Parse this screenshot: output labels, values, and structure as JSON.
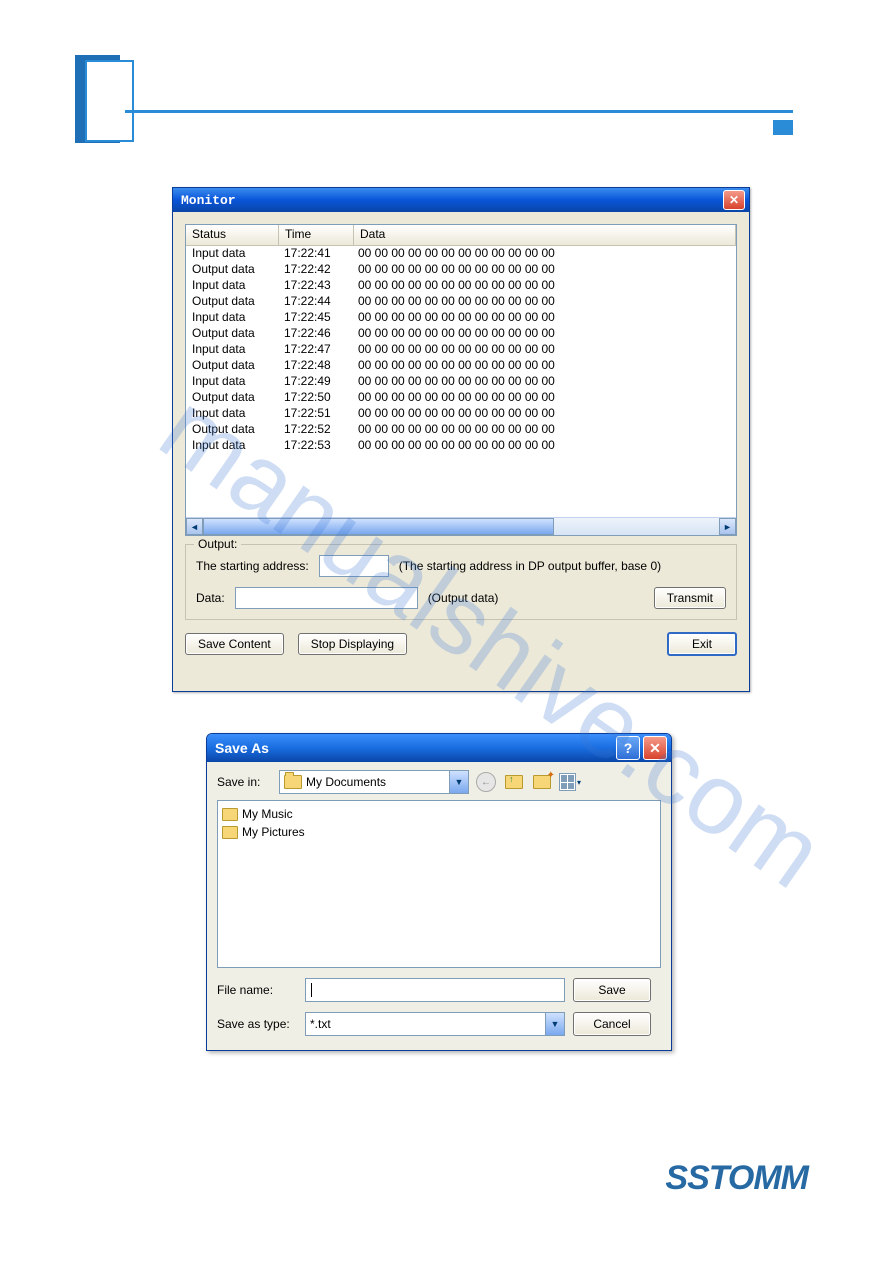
{
  "watermark": "manualshive.com",
  "logo": "SSTOMM",
  "monitor": {
    "title": "Monitor",
    "columns": {
      "status": "Status",
      "time": "Time",
      "data": "Data"
    },
    "rows": [
      {
        "status": "Input data",
        "time": "17:22:41",
        "data": "00 00 00 00 00 00 00 00 00 00 00 00"
      },
      {
        "status": "Output data",
        "time": "17:22:42",
        "data": "00 00 00 00 00 00 00 00 00 00 00 00"
      },
      {
        "status": "Input data",
        "time": "17:22:43",
        "data": "00 00 00 00 00 00 00 00 00 00 00 00"
      },
      {
        "status": "Output data",
        "time": "17:22:44",
        "data": "00 00 00 00 00 00 00 00 00 00 00 00"
      },
      {
        "status": "Input data",
        "time": "17:22:45",
        "data": "00 00 00 00 00 00 00 00 00 00 00 00"
      },
      {
        "status": "Output data",
        "time": "17:22:46",
        "data": "00 00 00 00 00 00 00 00 00 00 00 00"
      },
      {
        "status": "Input data",
        "time": "17:22:47",
        "data": "00 00 00 00 00 00 00 00 00 00 00 00"
      },
      {
        "status": "Output data",
        "time": "17:22:48",
        "data": "00 00 00 00 00 00 00 00 00 00 00 00"
      },
      {
        "status": "Input data",
        "time": "17:22:49",
        "data": "00 00 00 00 00 00 00 00 00 00 00 00"
      },
      {
        "status": "Output data",
        "time": "17:22:50",
        "data": "00 00 00 00 00 00 00 00 00 00 00 00"
      },
      {
        "status": "Input data",
        "time": "17:22:51",
        "data": "00 00 00 00 00 00 00 00 00 00 00 00"
      },
      {
        "status": "Output data",
        "time": "17:22:52",
        "data": "00 00 00 00 00 00 00 00 00 00 00 00"
      },
      {
        "status": "Input data",
        "time": "17:22:53",
        "data": "00 00 00 00 00 00 00 00 00 00 00 00"
      }
    ],
    "output_group": {
      "legend": "Output:",
      "start_addr_label": "The starting address:",
      "start_addr_value": "",
      "start_addr_hint": "(The starting address in DP output buffer, base 0)",
      "data_label": "Data:",
      "data_value": "",
      "data_hint": "(Output data)",
      "transmit": "Transmit"
    },
    "save_content": "Save Content",
    "stop_displaying": "Stop Displaying",
    "exit": "Exit"
  },
  "save_as": {
    "title": "Save As",
    "save_in_label": "Save in:",
    "save_in_value": "My Documents",
    "items": [
      {
        "name": "My Music"
      },
      {
        "name": "My Pictures"
      }
    ],
    "file_name_label": "File name:",
    "file_name_value": "",
    "save_type_label": "Save as type:",
    "save_type_value": "*.txt",
    "save_btn": "Save",
    "cancel_btn": "Cancel"
  }
}
